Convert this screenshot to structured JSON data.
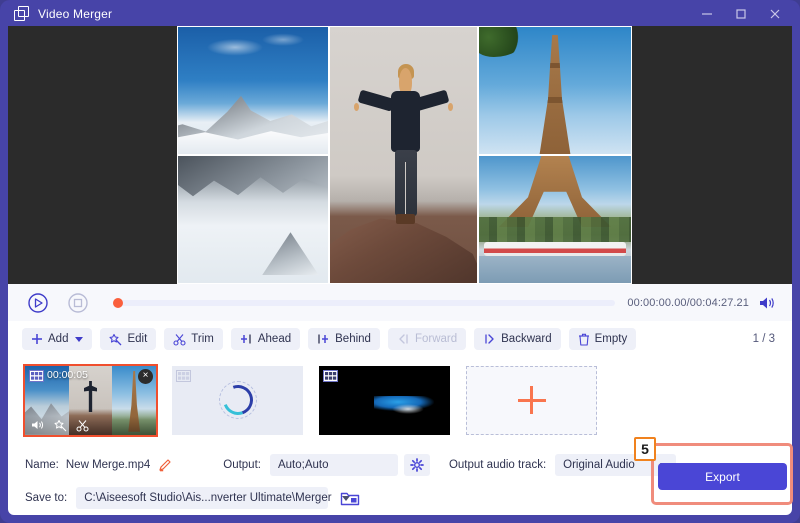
{
  "window": {
    "title": "Video Merger",
    "icon": "windows-stack-icon",
    "controls": [
      {
        "name": "minimize-button",
        "glyph": "minimize-icon"
      },
      {
        "name": "maximize-button",
        "glyph": "maximize-icon"
      },
      {
        "name": "close-button",
        "glyph": "close-icon"
      }
    ]
  },
  "preview": {
    "layout": "3-column collage",
    "cells": [
      {
        "name": "preview-cell-mountain-top",
        "caption": "Snowy mountain peak under blue sky"
      },
      {
        "name": "preview-cell-mountain-bottom",
        "caption": "Snowfield with rocky ridge"
      },
      {
        "name": "preview-cell-man-jumping",
        "caption": "Man jumping above rock with arms out"
      },
      {
        "name": "preview-cell-eiffel-top",
        "caption": "Eiffel Tower upper section"
      },
      {
        "name": "preview-cell-eiffel-bottom",
        "caption": "Eiffel Tower base with river boat"
      }
    ]
  },
  "player": {
    "play_button": "play-icon",
    "stop_button": "stop-icon",
    "time": "00:00:00.00/00:04:27.21",
    "volume_button": "volume-icon",
    "progress_percent": 0,
    "playhead_color": "#fa5f3c"
  },
  "toolbar": {
    "buttons": [
      {
        "label": "Add",
        "icon": "plus-icon",
        "dropdown": true,
        "disabled": false
      },
      {
        "label": "Edit",
        "icon": "magic-wand-icon",
        "dropdown": false,
        "disabled": false
      },
      {
        "label": "Trim",
        "icon": "scissors-icon",
        "dropdown": false,
        "disabled": false
      },
      {
        "label": "Ahead",
        "icon": "insert-ahead-icon",
        "dropdown": false,
        "disabled": false
      },
      {
        "label": "Behind",
        "icon": "insert-behind-icon",
        "dropdown": false,
        "disabled": false
      },
      {
        "label": "Forward",
        "icon": "move-forward-icon",
        "dropdown": false,
        "disabled": true
      },
      {
        "label": "Backward",
        "icon": "move-backward-icon",
        "dropdown": false,
        "disabled": false
      },
      {
        "label": "Empty",
        "icon": "trash-icon",
        "dropdown": false,
        "disabled": false
      }
    ],
    "page_indicator": "1 / 3"
  },
  "clips": [
    {
      "name": "clip-1",
      "duration": "00:00:05",
      "selected": true,
      "state": "ready",
      "film_badge": "film-strip-icon",
      "close": "×",
      "tools": [
        "volume-icon",
        "magic-wand-icon",
        "scissors-icon"
      ]
    },
    {
      "name": "clip-2",
      "state": "loading",
      "film_badge": "film-strip-icon"
    },
    {
      "name": "clip-3",
      "state": "ready-dark",
      "film_badge": "film-strip-icon"
    },
    {
      "name": "clip-add",
      "state": "add-placeholder",
      "icon": "plus-icon"
    }
  ],
  "settings": {
    "name_label": "Name:",
    "name_value": "New Merge.mp4",
    "name_edit_icon": "pencil-icon",
    "output_label": "Output:",
    "output_value": "Auto;Auto",
    "output_settings_icon": "gear-icon",
    "audio_track_label": "Output audio track:",
    "audio_track_value": "Original Audio",
    "save_to_label": "Save to:",
    "save_to_value": "C:\\Aiseesoft Studio\\Ais...nverter Ultimate\\Merger",
    "browse_icon": "folder-icon"
  },
  "export": {
    "label": "Export",
    "step_badge": "5",
    "button_color": "#4a46d6",
    "highlight_color": "#f08c7c",
    "badge_border_color": "#f0821e"
  }
}
